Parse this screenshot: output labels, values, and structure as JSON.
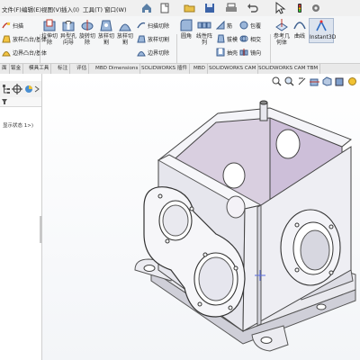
{
  "menubar": {
    "items": [
      "文件(F)",
      "编辑(E)",
      "视图(V)",
      "插入(I)",
      "工具(T)",
      "窗口(W)"
    ]
  },
  "ribbon": {
    "sweep": "扫描",
    "lofted_base": "放样凸台/基体",
    "boundary_base": "边界凸台/基体",
    "extrude_cut": "拉伸切除",
    "hole_wizard": "异型孔向导",
    "revolve_cut": "旋转切除",
    "lofted_cut": "放样切割",
    "sweep_cut": "扫描切除",
    "lofted_cut2": "放样切割",
    "boundary_cut": "边界切除",
    "fillet": "圆角",
    "linear_pattern": "线性阵列",
    "rib": "筋",
    "draft": "拔模",
    "shell": "抽壳",
    "wrap": "包覆",
    "intersect": "相交",
    "mirror": "镜向",
    "ref_geometry": "参考几何体",
    "curves": "曲线",
    "instant3d": "Instant3D"
  },
  "tabs": [
    "面",
    "钣金",
    "模具工具",
    "标注",
    "评估",
    "MBD Dimensions",
    "SOLIDWORKS 插件",
    "MBD",
    "SOLIDWORKS CAM",
    "SOLIDWORKS CAM TBM"
  ],
  "feature_tree": {
    "state_text": "显示状态 1>)"
  }
}
